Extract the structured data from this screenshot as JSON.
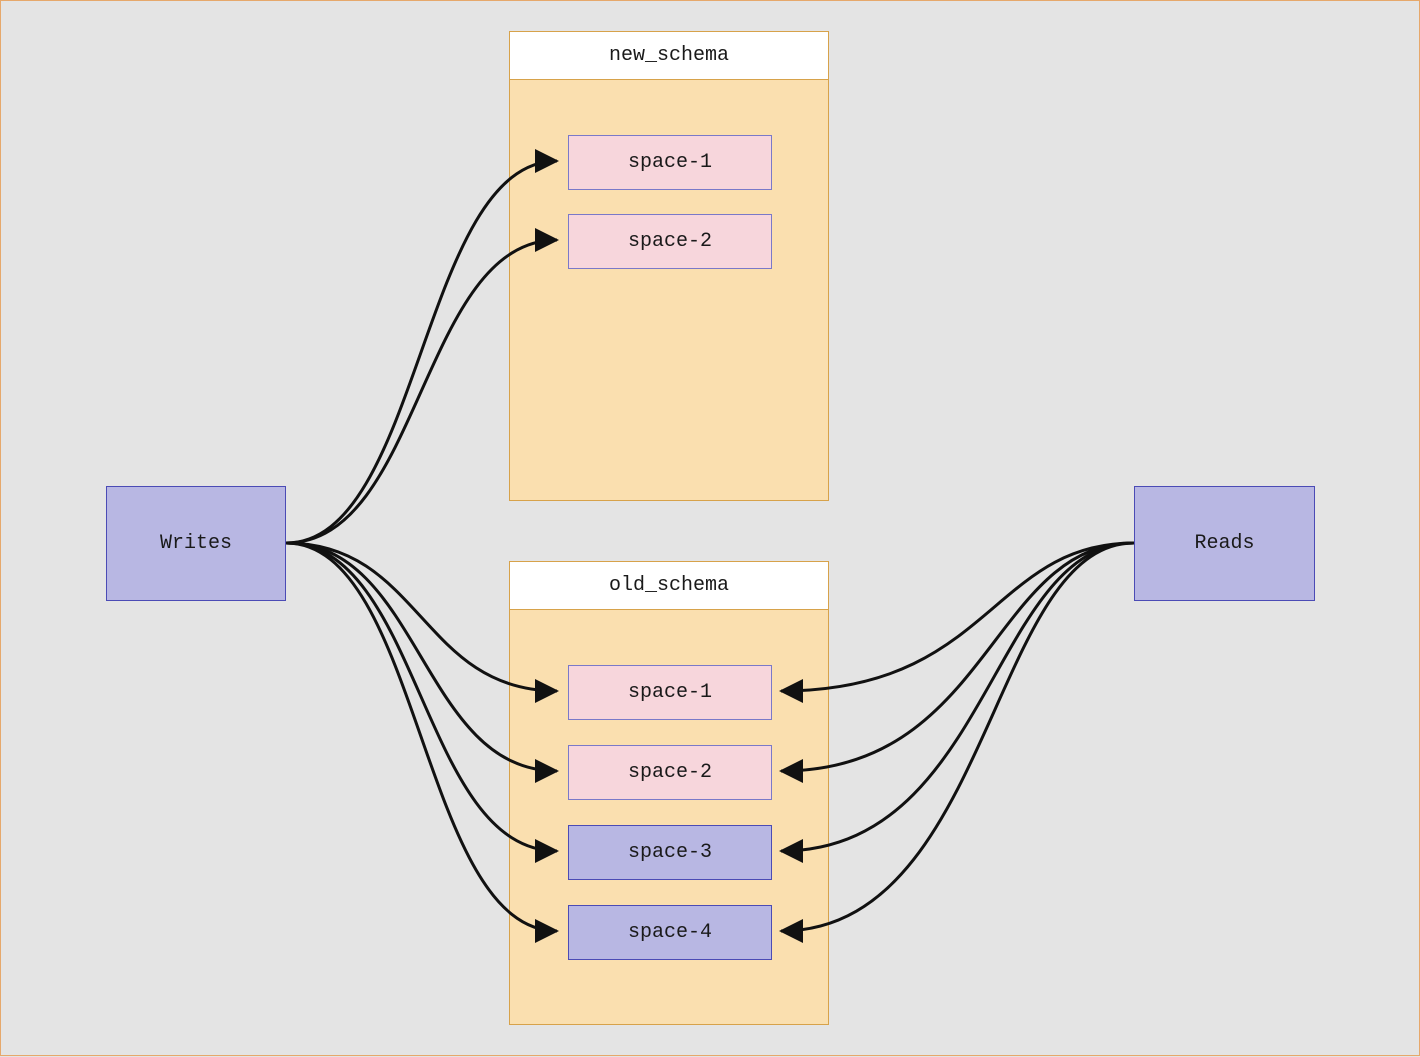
{
  "actors": {
    "writes": {
      "label": "Writes"
    },
    "reads": {
      "label": "Reads"
    }
  },
  "schemas": {
    "new": {
      "title": "new_schema",
      "spaces": [
        {
          "label": "space-1",
          "variant": "pink"
        },
        {
          "label": "space-2",
          "variant": "pink"
        }
      ]
    },
    "old": {
      "title": "old_schema",
      "spaces": [
        {
          "label": "space-1",
          "variant": "pink"
        },
        {
          "label": "space-2",
          "variant": "pink"
        },
        {
          "label": "space-3",
          "variant": "blue"
        },
        {
          "label": "space-4",
          "variant": "blue"
        }
      ]
    }
  },
  "edges": {
    "writes_to": [
      "new.space-1",
      "new.space-2",
      "old.space-1",
      "old.space-2",
      "old.space-3",
      "old.space-4"
    ],
    "reads_from": [
      "old.space-1",
      "old.space-2",
      "old.space-3",
      "old.space-4"
    ]
  },
  "colors": {
    "frame_border": "#e6a86b",
    "canvas_bg": "#e4e4e4",
    "actor_fill": "#b8b7e3",
    "actor_stroke": "#4b4bb5",
    "schema_fill": "#fadfaf",
    "schema_stroke": "#d7a24a",
    "space_pink_fill": "#f7d6dc",
    "space_blue_fill": "#b8b7e3",
    "edge_stroke": "#111111"
  }
}
